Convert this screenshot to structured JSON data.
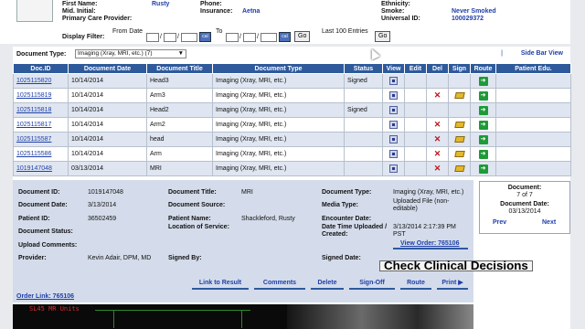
{
  "patient": {
    "first_name_label": "First Name:",
    "first_name": "Rusty",
    "mid_initial_label": "Mid. Initial:",
    "pcp_label": "Primary Care Provider:",
    "phone_label": "Phone:",
    "insurance_label": "Insurance:",
    "insurance": "Aetna",
    "ethnicity_label": "Ethnicity:",
    "smoke_label": "Smoke:",
    "smoke": "Never Smoked",
    "universal_id_label": "Universal ID:",
    "universal_id": "100029372"
  },
  "filter": {
    "label": "Display Filter:",
    "from_label": "From Date",
    "to_label": "To",
    "date_sep": "/",
    "cal_label": "cal",
    "go_label": "Go",
    "last100_label": "Last 100 Entries"
  },
  "doctype": {
    "label": "Document Type:",
    "selected": "Imaging (Xray, MRI, etc.) (7)",
    "arrow": "▼",
    "side_bar_view": "Side Bar View",
    "side_bar_sep": "|"
  },
  "table": {
    "columns": [
      "Doc.ID",
      "Document Date",
      "Document Title",
      "Document Type",
      "Status",
      "View",
      "Edit",
      "Del",
      "Sign",
      "Route",
      "Patient Edu."
    ],
    "rows": [
      {
        "id": "1025115820",
        "date": "10/14/2014",
        "title": "Head3",
        "type": "Imaging (Xray, MRI, etc.)",
        "status": "Signed",
        "del": false,
        "sign": false
      },
      {
        "id": "1025115819",
        "date": "10/14/2014",
        "title": "Arm3",
        "type": "Imaging (Xray, MRI, etc.)",
        "status": "",
        "del": true,
        "sign": true
      },
      {
        "id": "1025115818",
        "date": "10/14/2014",
        "title": "Head2",
        "type": "Imaging (Xray, MRI, etc.)",
        "status": "Signed",
        "del": false,
        "sign": false
      },
      {
        "id": "1025115817",
        "date": "10/14/2014",
        "title": "Arm2",
        "type": "Imaging (Xray, MRI, etc.)",
        "status": "",
        "del": true,
        "sign": true
      },
      {
        "id": "1025115587",
        "date": "10/14/2014",
        "title": "head",
        "type": "Imaging (Xray, MRI, etc.)",
        "status": "",
        "del": true,
        "sign": true
      },
      {
        "id": "1025115586",
        "date": "10/14/2014",
        "title": "Arm",
        "type": "Imaging (Xray, MRI, etc.)",
        "status": "",
        "del": true,
        "sign": true
      },
      {
        "id": "1019147048",
        "date": "03/13/2014",
        "title": "MRI",
        "type": "Imaging (Xray, MRI, etc.)",
        "status": "",
        "del": true,
        "sign": true
      }
    ],
    "del_glyph": "✕",
    "route_glyph": "➜"
  },
  "detail": {
    "doc_id_label": "Document ID:",
    "doc_id": "1019147048",
    "doc_date_label": "Document Date:",
    "doc_date": "3/13/2014",
    "patient_id_label": "Patient ID:",
    "patient_id": "36502459",
    "doc_status_label": "Document Status:",
    "upload_comments_label": "Upload Comments:",
    "provider_label": "Provider:",
    "provider": "Kevin Adair, DPM, MD",
    "doc_title_label": "Document Title:",
    "doc_title": "MRI",
    "doc_source_label": "Document Source:",
    "patient_name_label": "Patient Name:",
    "patient_name": "Shackleford, Rusty",
    "location_label": "Location of Service:",
    "signed_by_label": "Signed By:",
    "doc_type_label": "Document Type:",
    "doc_type": "Imaging (Xray, MRI, etc.)",
    "media_type_label": "Media Type:",
    "media_type_1": "Uploaded File (non-",
    "media_type_2": "editable)",
    "encounter_label": "Encounter Date:",
    "dt_uploaded_label_1": "Date Time Uploaded /",
    "dt_uploaded_label_2": "Created:",
    "dt_uploaded_1": "3/13/2014 2:17:39 PM",
    "dt_uploaded_2": "PST",
    "view_order": "View Order: 765106",
    "signed_date_label": "Signed Date:",
    "check_clinical": "Check Clinical Decisions",
    "order_link": "Order Link: 765106"
  },
  "actions": [
    "Link to Result",
    "Comments",
    "Delete",
    "Sign-Off",
    "Route",
    "Print ▶"
  ],
  "side": {
    "doc_label": "Document:",
    "doc_count": "7 of 7",
    "doc_date_label": "Document Date:",
    "doc_date": "03/13/2014",
    "prev": "Prev",
    "next": "Next"
  },
  "viewer": {
    "label": "SL45 MR Units"
  }
}
